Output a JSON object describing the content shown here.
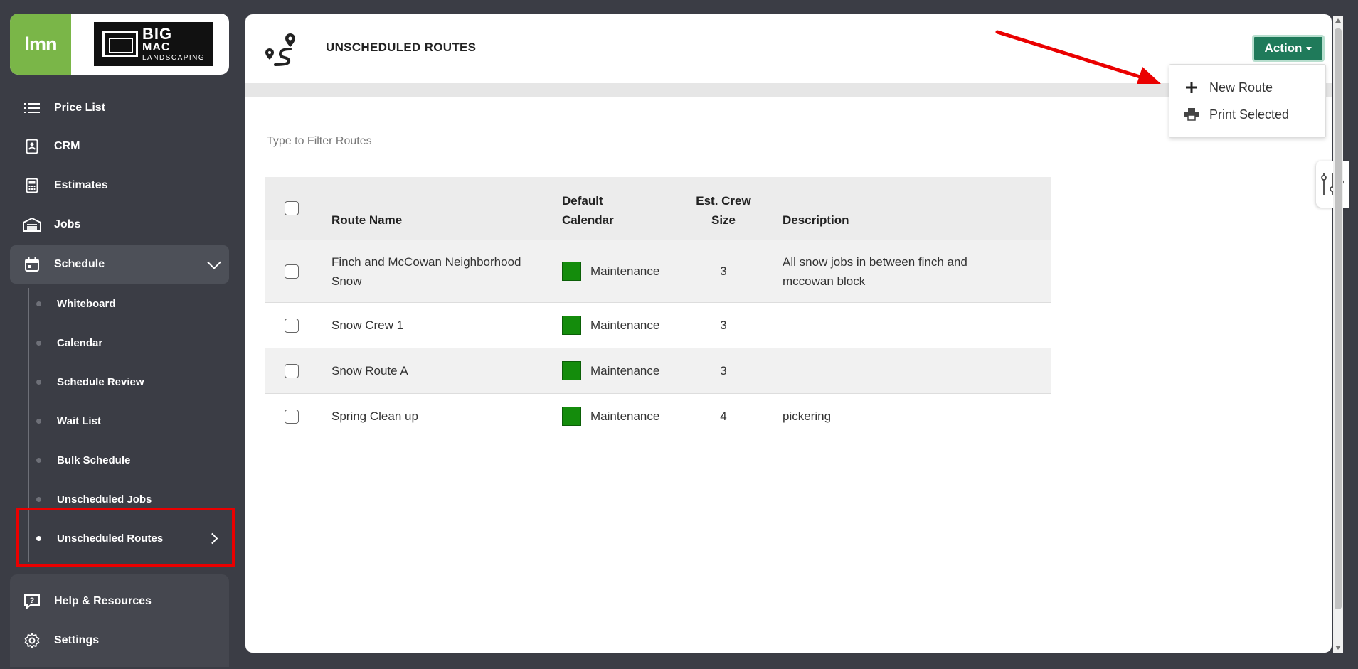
{
  "brand": {
    "lmn_logo_text": "lmn",
    "company_logo_line1": "BIG",
    "company_logo_line2": "MAC",
    "company_logo_line3": "LANDSCAPING"
  },
  "sidebar": {
    "items": [
      {
        "label": "Price List",
        "icon": "list-icon"
      },
      {
        "label": "CRM",
        "icon": "contact-card-icon"
      },
      {
        "label": "Estimates",
        "icon": "calculator-icon"
      },
      {
        "label": "Jobs",
        "icon": "warehouse-icon"
      },
      {
        "label": "Schedule",
        "icon": "calendar-icon",
        "expanded": true
      }
    ],
    "schedule_sub_items": [
      {
        "label": "Whiteboard"
      },
      {
        "label": "Calendar"
      },
      {
        "label": "Schedule Review"
      },
      {
        "label": "Wait List"
      },
      {
        "label": "Bulk Schedule"
      },
      {
        "label": "Unscheduled Jobs"
      },
      {
        "label": "Unscheduled Routes",
        "active": true
      }
    ],
    "bottom_items": [
      {
        "label": "Help & Resources",
        "icon": "help-icon"
      },
      {
        "label": "Settings",
        "icon": "gear-icon"
      }
    ]
  },
  "header": {
    "title": "UNSCHEDULED ROUTES",
    "action_label": "Action"
  },
  "action_menu": [
    {
      "label": "New Route",
      "icon": "plus-icon"
    },
    {
      "label": "Print Selected",
      "icon": "printer-icon"
    }
  ],
  "filter": {
    "placeholder": "Type to Filter Routes",
    "value": ""
  },
  "table": {
    "columns": {
      "route_name": "Route Name",
      "default_calendar_line1": "Default",
      "default_calendar_line2": "Calendar",
      "crew_size_line1": "Est. Crew",
      "crew_size_line2": "Size",
      "description": "Description"
    },
    "rows": [
      {
        "name_line1": "Finch and McCowan Neighborhood",
        "name_line2": "Snow",
        "calendar": "Maintenance",
        "crew_size": "3",
        "description_line1": "All snow jobs in between finch and",
        "description_line2": "mccowan block"
      },
      {
        "name_line1": "Snow Crew 1",
        "name_line2": "",
        "calendar": "Maintenance",
        "crew_size": "3",
        "description_line1": "",
        "description_line2": ""
      },
      {
        "name_line1": "Snow Route A",
        "name_line2": "",
        "calendar": "Maintenance",
        "crew_size": "3",
        "description_line1": "",
        "description_line2": ""
      },
      {
        "name_line1": "Spring Clean up",
        "name_line2": "",
        "calendar": "Maintenance",
        "crew_size": "4",
        "description_line1": "pickering",
        "description_line2": ""
      }
    ]
  },
  "colors": {
    "accent_green": "#1f7a5a",
    "calendar_swatch": "#148c0c",
    "highlight_red": "#ea0000",
    "lmn_green": "#7ab648"
  }
}
